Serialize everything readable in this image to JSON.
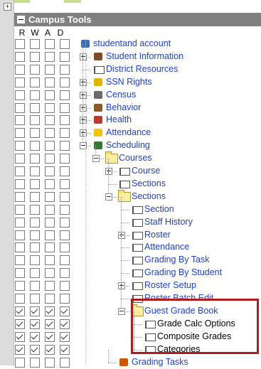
{
  "window": {
    "title": "Campus Tools"
  },
  "columns": [
    "R",
    "W",
    "A",
    "D"
  ],
  "rows": [
    {
      "label": "studentand account",
      "checked": false,
      "icon": "account-icon",
      "expander": "none"
    },
    {
      "label": "Student Information",
      "checked": false,
      "icon": "student-info-icon",
      "expander": "plus"
    },
    {
      "label": "District Resources",
      "checked": false,
      "icon": "page-icon",
      "expander": "none"
    },
    {
      "label": "SSN Rights",
      "checked": false,
      "icon": "lock-icon",
      "expander": "plus"
    },
    {
      "label": "Census",
      "checked": false,
      "icon": "census-icon",
      "expander": "plus"
    },
    {
      "label": "Behavior",
      "checked": false,
      "icon": "behavior-icon",
      "expander": "plus"
    },
    {
      "label": "Health",
      "checked": false,
      "icon": "health-icon",
      "expander": "plus"
    },
    {
      "label": "Attendance",
      "checked": false,
      "icon": "attendance-icon",
      "expander": "plus"
    },
    {
      "label": "Scheduling",
      "checked": false,
      "icon": "scheduling-icon",
      "expander": "minus"
    },
    {
      "label": "Courses",
      "checked": false,
      "icon": "folder-open-icon",
      "expander": "minus"
    },
    {
      "label": "Course",
      "checked": false,
      "icon": "page-icon",
      "expander": "plus"
    },
    {
      "label": "Sections",
      "checked": false,
      "icon": "page-icon",
      "expander": "none"
    },
    {
      "label": "Sections",
      "checked": false,
      "icon": "folder-open-icon",
      "expander": "minus"
    },
    {
      "label": "Section",
      "checked": false,
      "icon": "page-icon",
      "expander": "none"
    },
    {
      "label": "Staff History",
      "checked": false,
      "icon": "page-icon",
      "expander": "none"
    },
    {
      "label": "Roster",
      "checked": false,
      "icon": "page-icon",
      "expander": "plus"
    },
    {
      "label": "Attendance",
      "checked": false,
      "icon": "page-icon",
      "expander": "none"
    },
    {
      "label": "Grading By Task",
      "checked": false,
      "icon": "page-icon",
      "expander": "none"
    },
    {
      "label": "Grading By Student",
      "checked": false,
      "icon": "page-icon",
      "expander": "none"
    },
    {
      "label": "Roster Setup",
      "checked": false,
      "icon": "page-icon",
      "expander": "plus"
    },
    {
      "label": "Roster Batch Edit",
      "checked": false,
      "icon": "page-icon",
      "expander": "none"
    },
    {
      "label": "Guest Grade Book",
      "checked": true,
      "icon": "folder-open-icon",
      "expander": "minus"
    },
    {
      "label": "Grade Calc Options",
      "checked": true,
      "icon": "page-icon",
      "expander": "none"
    },
    {
      "label": "Composite Grades",
      "checked": true,
      "icon": "page-icon",
      "expander": "none"
    },
    {
      "label": "Categories",
      "checked": true,
      "icon": "page-icon",
      "expander": "none"
    },
    {
      "label": "Grading Tasks",
      "checked": false,
      "icon": "grading-tasks-icon",
      "expander": "none"
    }
  ],
  "colors": {
    "link": "#1f3fd6",
    "header_bg": "#808080",
    "highlight_border": "#b11c1c"
  }
}
